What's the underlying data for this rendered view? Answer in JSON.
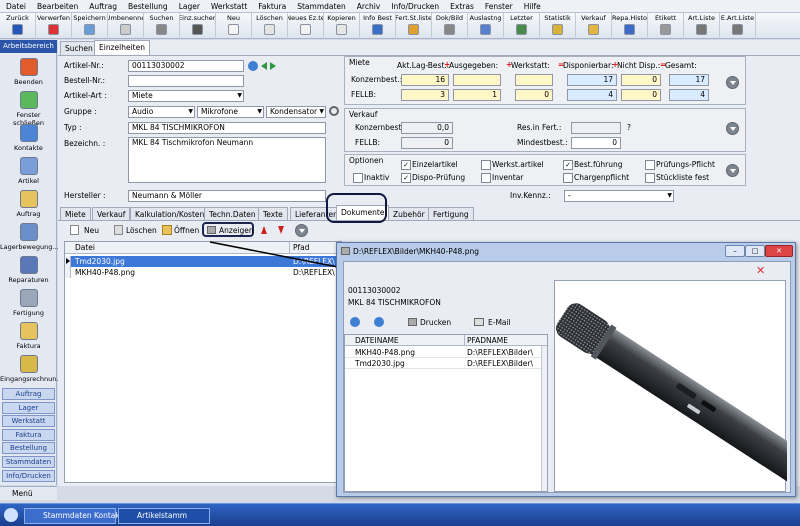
{
  "menu": [
    "Datei",
    "Bearbeiten",
    "Auftrag",
    "Bestellung",
    "Lager",
    "Werkstatt",
    "Faktura",
    "Stammdaten",
    "Archiv",
    "Info/Drucken",
    "Extras",
    "Fenster",
    "Hilfe"
  ],
  "toolbar": [
    {
      "label": "Zurück",
      "w": 36,
      "color": "#2457b8"
    },
    {
      "label": "Verwerfen",
      "w": 36,
      "color": "#d33"
    },
    {
      "label": "Speichern",
      "w": 36,
      "color": "#6a9ed8"
    },
    {
      "label": "Umbenenne",
      "w": 36,
      "color": "#ccc"
    },
    {
      "label": "Suchen",
      "w": 36,
      "color": "#888"
    },
    {
      "label": "Einz.suchen",
      "w": 36,
      "color": "#555"
    },
    {
      "label": "Neu",
      "w": 36,
      "color": "#f4f4f4"
    },
    {
      "label": "Löschen",
      "w": 36,
      "color": "#e4e4e4"
    },
    {
      "label": "Neues Ez.te",
      "w": 36,
      "color": "#f2f2f2"
    },
    {
      "label": "Kopieren",
      "w": 36,
      "color": "#e6e6e6"
    },
    {
      "label": "Info Best",
      "w": 36,
      "color": "#3a6fc6"
    },
    {
      "label": "Fert.St.liste",
      "w": 36,
      "color": "#e0a030"
    },
    {
      "label": "Dok/Bild",
      "w": 36,
      "color": "#888"
    },
    {
      "label": "Auslastng",
      "w": 36,
      "color": "#5b7fd0"
    },
    {
      "label": "Letzter",
      "w": 36,
      "color": "#4a8a4a"
    },
    {
      "label": "Statistik",
      "w": 36,
      "color": "#d9b23a"
    },
    {
      "label": "Verkauf",
      "w": 36,
      "color": "#e4b640"
    },
    {
      "label": "Repa.Histo",
      "w": 36,
      "color": "#3d6cc8"
    },
    {
      "label": "Etikett",
      "w": 36,
      "color": "#999"
    },
    {
      "label": "Art.Liste",
      "w": 36,
      "color": "#777"
    },
    {
      "label": "E.Art.Liste",
      "w": 36,
      "color": "#777"
    }
  ],
  "sidebar": {
    "header": "Arbeitsbereich",
    "items": [
      {
        "label": "Beenden",
        "color": "#e25b2a"
      },
      {
        "label": "Fenster schließen",
        "color": "#5bb85b"
      },
      {
        "label": "Kontakte",
        "color": "#4d84d6"
      },
      {
        "label": "Artikel",
        "color": "#7a9ed8"
      },
      {
        "label": "Auftrag",
        "color": "#e6c35c"
      },
      {
        "label": "Lagerbewegung...",
        "color": "#6c8fca"
      },
      {
        "label": "Reparaturen",
        "color": "#5a78b8"
      },
      {
        "label": "Fertigung",
        "color": "#9aa7b8"
      },
      {
        "label": "Faktura",
        "color": "#e6c35c"
      },
      {
        "label": "Eingangsrechnun...",
        "color": "#d9b84a"
      }
    ],
    "buttons": [
      "Auftrag",
      "Lager",
      "Werkstatt",
      "Faktura",
      "Bestellung",
      "Stammdaten",
      "Info/Drucken"
    ],
    "menu": "Menü"
  },
  "tabs_top": [
    "Suchen",
    "Einzelheiten"
  ],
  "form": {
    "artikelnr_label": "Artikel-Nr.:",
    "artikelnr": "00113030002",
    "bestellnr_label": "Bestell-Nr.:",
    "bestellnr": "",
    "artikelart_label": "Artikel-Art :",
    "artikelart": "Miete",
    "gruppe_label": "Gruppe :",
    "gruppe1": "Audio",
    "gruppe2": "Mikrofone",
    "gruppe3": "Kondensator",
    "typ_label": "Typ :",
    "typ": "MKL 84 TISCHMIKROFON",
    "bezeichn_label": "Bezeichn. :",
    "bezeichn": "MKL 84 Tischmikrofon Neumann",
    "hersteller_label": "Hersteller :",
    "hersteller": "Neumann & Möller",
    "invkennz_label": "Inv.Kennz.:",
    "invkennz": "-"
  },
  "miete": {
    "title": "Miete",
    "headers": [
      "Akt.Lag-Best.:",
      "Ausgegeben:",
      "Werkstatt:",
      "Disponierbar:",
      "Nicht Disp.:",
      "Gesamt:"
    ],
    "ops": [
      "+",
      "+",
      "=",
      "+",
      "="
    ],
    "rows": [
      {
        "label": "Konzernbest.:",
        "values": [
          "16",
          "",
          "",
          "17",
          "0",
          "17"
        ]
      },
      {
        "label": "FELLB:",
        "values": [
          "3",
          "1",
          "0",
          "4",
          "0",
          "4"
        ]
      }
    ]
  },
  "verkauf": {
    "title": "Verkauf",
    "konzern_label": "Konzernbest.:",
    "konzern": "0,0",
    "fellb_label": "FELLB:",
    "fellb": "0",
    "resfert_label": "Res.in Fert.:",
    "resfert": "",
    "resfert_q": "?",
    "mindest_label": "Mindestbest.:",
    "mindest": "0"
  },
  "optionen": {
    "title": "Optionen",
    "items": [
      {
        "label": "Einzelartikel",
        "checked": true
      },
      {
        "label": "Werkst.artikel",
        "checked": false
      },
      {
        "label": "Best.führung",
        "checked": true
      },
      {
        "label": "Prüfungs-Pflicht",
        "checked": false
      },
      {
        "label": "Inaktiv",
        "checked": false
      },
      {
        "label": "Dispo-Prüfung",
        "checked": true
      },
      {
        "label": "Inventar",
        "checked": false
      },
      {
        "label": "Chargenpflicht",
        "checked": false
      },
      {
        "label": "Stückliste fest",
        "checked": false
      }
    ]
  },
  "tabs_bottom": [
    "Miete",
    "Verkauf",
    "Kalkulation/Kosten",
    "Techn.Daten",
    "Texte",
    "Lieferanten",
    "Dokumente",
    "Zubehör",
    "Fertigung"
  ],
  "doc_toolbar": {
    "neu": "Neu",
    "loeschen": "Löschen",
    "oeffnen": "Öffnen",
    "anzeigen": "Anzeigen"
  },
  "doc_table": {
    "col_datei": "Datei",
    "col_pfad": "Pfad",
    "rows": [
      {
        "datei": "Tmd2030.jpg",
        "pfad": "D:\\REFLEX\\"
      },
      {
        "datei": "MKH40-P48.png",
        "pfad": "D:\\REFLEX\\"
      }
    ]
  },
  "popup": {
    "title": "D:\\REFLEX\\Bilder\\MKH40-P48.png",
    "artnr": "00113030002",
    "name": "MKL 84 TISCHMIKROFON",
    "drucken": "Drucken",
    "email": "E-Mail",
    "col1": "DATEINAME",
    "col2": "PFADNAME",
    "rows": [
      {
        "name": "MKH40-P48.png",
        "pfad": "D:\\REFLEX\\Bilder\\"
      },
      {
        "name": "Tmd2030.jpg",
        "pfad": "D:\\REFLEX\\Bilder\\"
      }
    ]
  },
  "taskbar": [
    "Stammdaten Kontakte",
    "Artikelstamm"
  ]
}
